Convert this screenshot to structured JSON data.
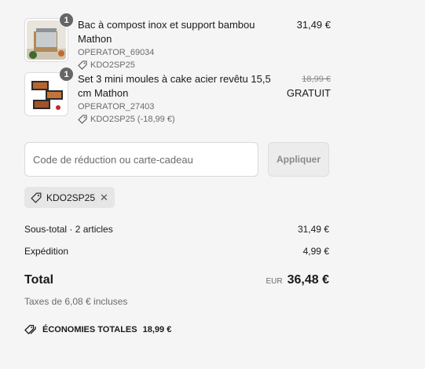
{
  "items": [
    {
      "quantity": "1",
      "name": "Bac à compost inox et support bambou Mathon",
      "sku": "OPERATOR_69034",
      "discount": "KDO2SP25",
      "price": "31,49 €"
    },
    {
      "quantity": "1",
      "name": "Set 3 mini moules à cake acier revêtu 15,5 cm Mathon",
      "sku": "OPERATOR_27403",
      "discount": "KDO2SP25 (-18,99 €)",
      "original_price": "18,99 €",
      "price": "GRATUIT"
    }
  ],
  "discount_form": {
    "placeholder": "Code de réduction ou carte-cadeau",
    "apply_label": "Appliquer"
  },
  "applied_code": "KDO2SP25",
  "summary": {
    "subtotal_label": "Sous-total · 2 articles",
    "subtotal_value": "31,49 €",
    "shipping_label": "Expédition",
    "shipping_value": "4,99 €",
    "total_label": "Total",
    "currency": "EUR",
    "total_value": "36,48 €",
    "taxes": "Taxes de 6,08 € incluses",
    "savings_label": "ÉCONOMIES TOTALES",
    "savings_value": "18,99 €"
  }
}
